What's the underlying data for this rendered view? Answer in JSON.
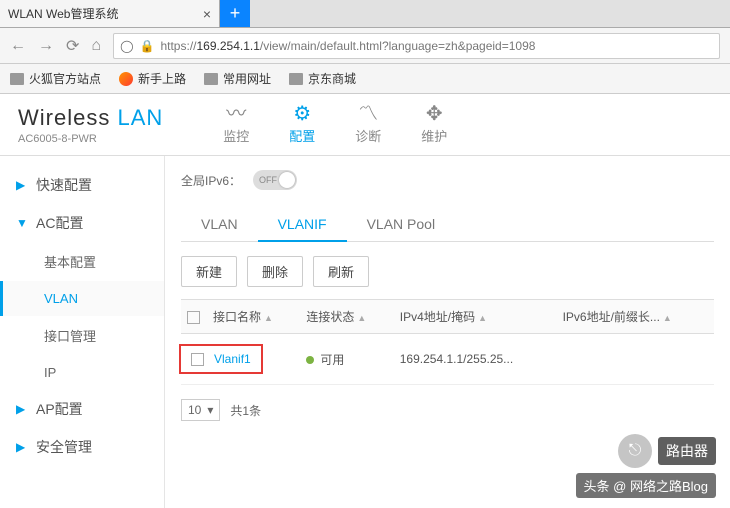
{
  "browser": {
    "tab_title": "WLAN Web管理系统",
    "url_prefix": "https://",
    "url_host": "169.254.1.1",
    "url_path": "/view/main/default.html?language=zh&pageid=1098",
    "bookmarks": [
      "火狐官方站点",
      "新手上路",
      "常用网址",
      "京东商城"
    ]
  },
  "brand": {
    "title_a": "Wireless ",
    "title_b": "LAN",
    "model": "AC6005-8-PWR"
  },
  "topnav": {
    "items": [
      {
        "icon": "〰",
        "label": "监控"
      },
      {
        "icon": "⚙",
        "label": "配置"
      },
      {
        "icon": "〽",
        "label": "诊断"
      },
      {
        "icon": "✥",
        "label": "维护"
      }
    ],
    "active_index": 1
  },
  "sidebar": {
    "items": [
      {
        "label": "快速配置",
        "expand": "right"
      },
      {
        "label": "AC配置",
        "expand": "down",
        "subs": [
          "基本配置",
          "VLAN",
          "接口管理",
          "IP"
        ],
        "active_sub": 1
      },
      {
        "label": "AP配置",
        "expand": "right"
      },
      {
        "label": "安全管理",
        "expand": "right"
      }
    ]
  },
  "content": {
    "ipv6_label": "全局IPv6：",
    "ipv6_toggle": "OFF",
    "tabs": [
      "VLAN",
      "VLANIF",
      "VLAN Pool"
    ],
    "active_tab": 1,
    "buttons": {
      "new": "新建",
      "del": "删除",
      "refresh": "刷新"
    },
    "columns": [
      "接口名称",
      "连接状态",
      "IPv4地址/掩码",
      "IPv6地址/前缀长..."
    ],
    "row": {
      "name": "Vlanif1",
      "status": "可用",
      "ipv4": "169.254.1.1/255.25..."
    },
    "pager": {
      "size": "10",
      "total": "共1条"
    }
  },
  "watermark": {
    "brand": "路由器",
    "author": "头条 @ 网络之路Blog"
  }
}
